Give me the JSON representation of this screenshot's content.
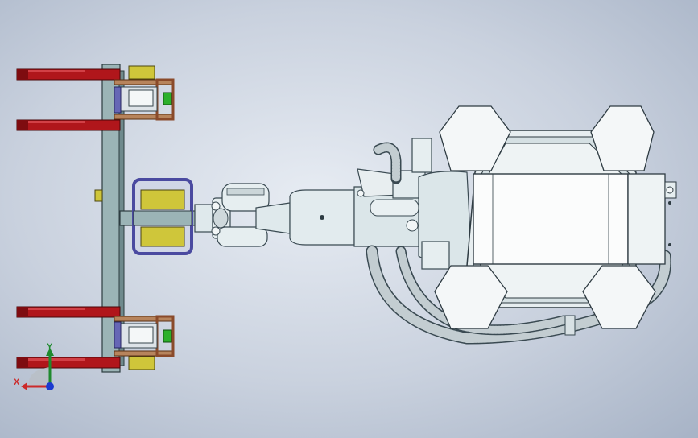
{
  "viewport": {
    "background_top": "#e7ecf3",
    "background_bottom": "#a7b3c6"
  },
  "model": {
    "subject": "robot-arm-with-gripper-fixture",
    "colors": {
      "body": "#dfe9ec",
      "outline": "#3a4a52",
      "fork": "#b0161b",
      "fork_dark": "#7e0c10",
      "frame": "#9bb4b6",
      "pad": "#cfc63a",
      "clamp": "#6666b5",
      "bracket": "#8a4a2a",
      "indicator": "#2bb02b",
      "plate": "#f4f7f8",
      "hose": "#c3cdd1"
    }
  },
  "triad": {
    "x_label": "X",
    "y_label": "Y",
    "x_color": "#cc2a2a",
    "y_color": "#1f8a2e",
    "z_color": "#1a3ad0"
  }
}
